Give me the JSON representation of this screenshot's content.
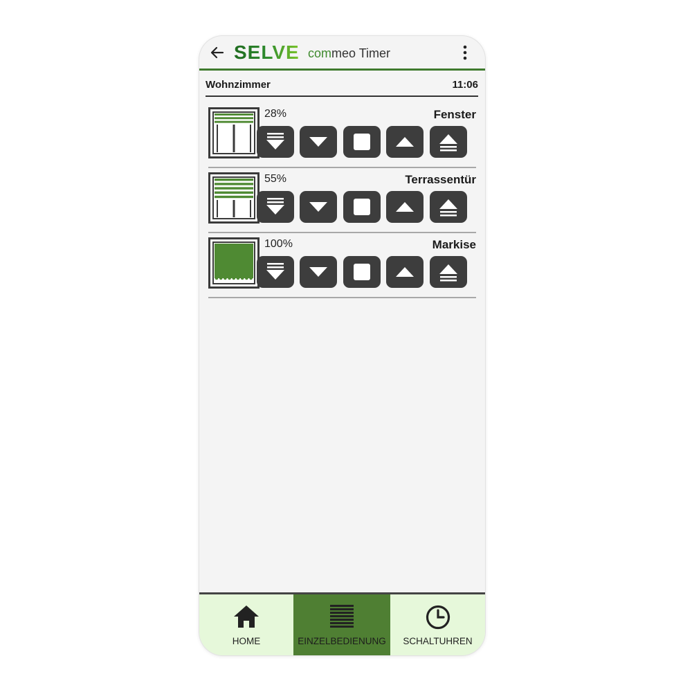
{
  "header": {
    "brand": "SELVE",
    "app_name_accent": "com",
    "app_name_rest": "meo Timer",
    "back_icon": "arrow-left-icon",
    "menu_icon": "more-vertical-icon"
  },
  "room": {
    "name": "Wohnzimmer",
    "time": "11:06"
  },
  "devices": [
    {
      "name": "Fenster",
      "position": "28%",
      "position_fraction": 0.28,
      "icon": "window-shutter-icon"
    },
    {
      "name": "Terrassentür",
      "position": "55%",
      "position_fraction": 0.55,
      "icon": "door-shutter-icon"
    },
    {
      "name": "Markise",
      "position": "100%",
      "position_fraction": 1.0,
      "icon": "awning-icon"
    }
  ],
  "controls": [
    "intermediate-down-icon",
    "down-icon",
    "stop-icon",
    "up-icon",
    "intermediate-up-icon"
  ],
  "nav": {
    "items": [
      {
        "label": "HOME",
        "icon": "home-icon"
      },
      {
        "label": "EINZELBEDIENUNG",
        "icon": "shutter-icon"
      },
      {
        "label": "SCHALTUHREN",
        "icon": "clock-icon"
      }
    ],
    "active_index": 1
  },
  "colors": {
    "brand_green": "#3f7a2e",
    "shutter_green": "#4f8a33",
    "nav_active": "#4f7f33",
    "nav_background": "#e6f8da",
    "button_dark": "#3d3d3d"
  }
}
